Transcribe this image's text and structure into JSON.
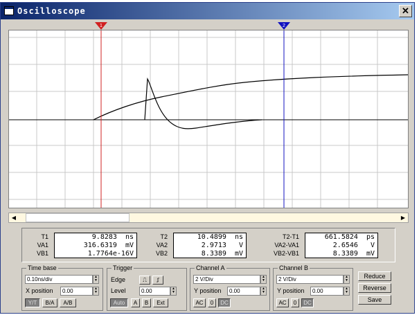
{
  "window": {
    "title": "Oscilloscope",
    "close_glyph": "✕"
  },
  "cursors": {
    "c1_label": "1",
    "c2_label": "2",
    "c1_color": "#d02020",
    "c2_color": "#1010c0"
  },
  "readout": {
    "t1_label": "T1",
    "t1_value": "9.8283  ns",
    "va1_label": "VA1",
    "va1_value": "316.6319  mV",
    "vb1_label": "VB1",
    "vb1_value": "1.7764e-16V",
    "t2_label": "T2",
    "t2_value": "10.4899  ns",
    "va2_label": "VA2",
    "va2_value": "2.9713   V",
    "vb2_label": "VB2",
    "vb2_value": "8.3389  mV",
    "dt_label": "T2-T1",
    "dt_value": "661.5824  ps",
    "dva_label": "VA2-VA1",
    "dva_value": "2.6546   V",
    "dvb_label": "VB2-VB1",
    "dvb_value": "8.3389  mV"
  },
  "timebase": {
    "title": "Time base",
    "value": "0.10ns/div",
    "xpos_label": "X position",
    "xpos_value": "0.00",
    "btn_yt": "Y/T",
    "btn_ba": "B/A",
    "btn_ab": "A/B"
  },
  "trigger": {
    "title": "Trigger",
    "edge_label": "Edge",
    "level_label": "Level",
    "level_value": "0.00",
    "btn_auto": "Auto",
    "btn_a": "A",
    "btn_b": "B",
    "btn_ext": "Ext"
  },
  "channel_a": {
    "title": "Channel A",
    "value": "2 V/Div",
    "ypos_label": "Y position",
    "ypos_value": "0.00",
    "btn_ac": "AC",
    "btn_0": "0",
    "btn_dc": "DC"
  },
  "channel_b": {
    "title": "Channel B",
    "value": "2 V/Div",
    "ypos_label": "Y position",
    "ypos_value": "0.00",
    "btn_ac": "AC",
    "btn_0": "0",
    "btn_dc": "DC"
  },
  "actions": {
    "reduce": "Reduce",
    "reverse": "Reverse",
    "save": "Save"
  }
}
